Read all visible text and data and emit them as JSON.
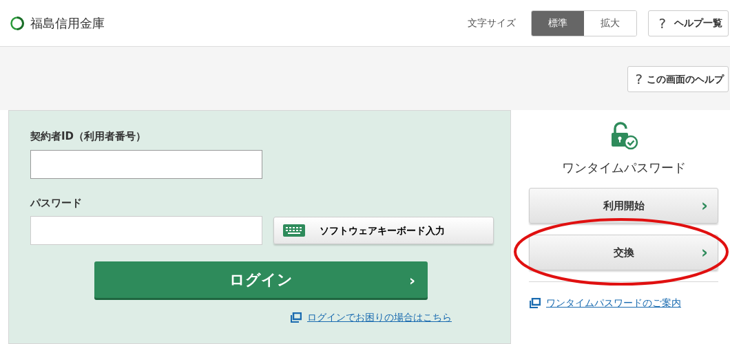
{
  "header": {
    "bank_name": "福島信用金庫",
    "font_size_label": "文字サイズ",
    "font_size_options": [
      {
        "label": "標準",
        "selected": true
      },
      {
        "label": "拡大",
        "selected": false
      }
    ],
    "help_list_button": {
      "icon": "?",
      "label": "ヘルプ一覧"
    }
  },
  "screen_help_button": {
    "icon": "?",
    "label": "この画面のヘルプ"
  },
  "login": {
    "id_label": "契約者ID（利用者番号）",
    "password_label": "パスワード",
    "keyboard_button": "ソフトウェアキーボード入力",
    "login_button": "ログイン",
    "login_arrow": "›",
    "trouble_link": "ログインでお困りの場合はこちら"
  },
  "onetime": {
    "title": "ワンタイムパスワード",
    "buttons": [
      {
        "label": "利用開始",
        "arrow": "›",
        "highlighted": false
      },
      {
        "label": "交換",
        "arrow": "›",
        "highlighted": true
      }
    ],
    "guide_link": "ワンタイムパスワードのご案内"
  }
}
